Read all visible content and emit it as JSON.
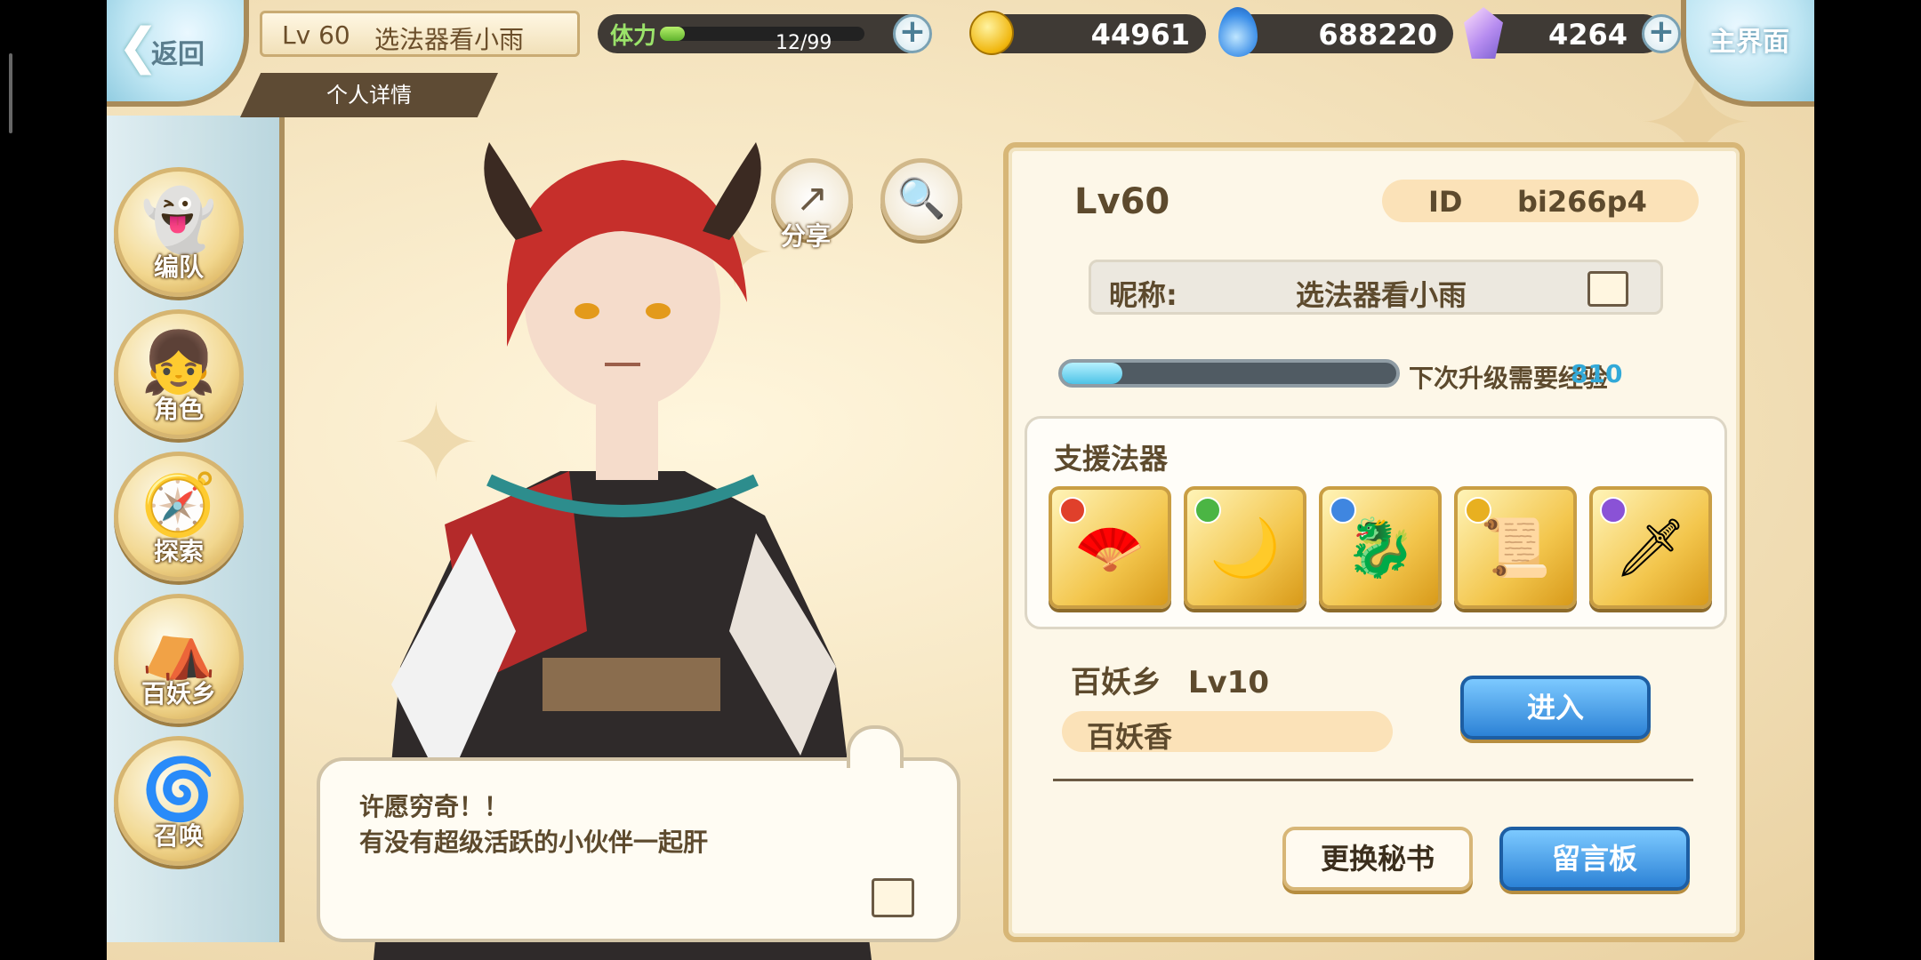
{
  "header": {
    "back_label": "返回",
    "level": "Lv 60",
    "player_name": "选法器看小雨",
    "tab_label": "个人详情",
    "home_label": "主界面"
  },
  "resources": {
    "stamina_label": "体力",
    "stamina_value": "12/99",
    "stamina_fraction": 0.12,
    "gold": "44961",
    "soul_fire": "688220",
    "crystal": "4264"
  },
  "nav": [
    {
      "label": "编队",
      "icon": "ghost-icon"
    },
    {
      "label": "角色",
      "icon": "character-icon"
    },
    {
      "label": "探索",
      "icon": "compass-icon"
    },
    {
      "label": "百妖乡",
      "icon": "village-icon"
    },
    {
      "label": "召唤",
      "icon": "summon-icon"
    }
  ],
  "actions": {
    "share_label": "分享"
  },
  "dialog": {
    "line1": "许愿穷奇！！",
    "line2": "有没有超级活跃的小伙伴一起肝"
  },
  "profile": {
    "level": "Lv60",
    "id_label": "ID",
    "id_value": "bi266p4",
    "nickname_label": "昵称:",
    "nickname": "选法器看小雨",
    "exp_label": "下次升级需要经验",
    "exp_value": "810",
    "exp_fraction": 0.18
  },
  "support": {
    "title": "支援法器",
    "cards": [
      {
        "icon": "fan-icon",
        "gem_color": "#e0402b"
      },
      {
        "icon": "ring-blade-icon",
        "gem_color": "#4bb544"
      },
      {
        "icon": "spirit-beast-icon",
        "gem_color": "#3f86e0"
      },
      {
        "icon": "scroll-icon",
        "gem_color": "#e8b020"
      },
      {
        "icon": "sword-icon",
        "gem_color": "#8a52d6"
      }
    ]
  },
  "village": {
    "name": "百妖乡",
    "level": "Lv10",
    "incense": "百妖香",
    "enter_label": "进入"
  },
  "buttons": {
    "change_secretary": "更换秘书",
    "message_board": "留言板"
  }
}
